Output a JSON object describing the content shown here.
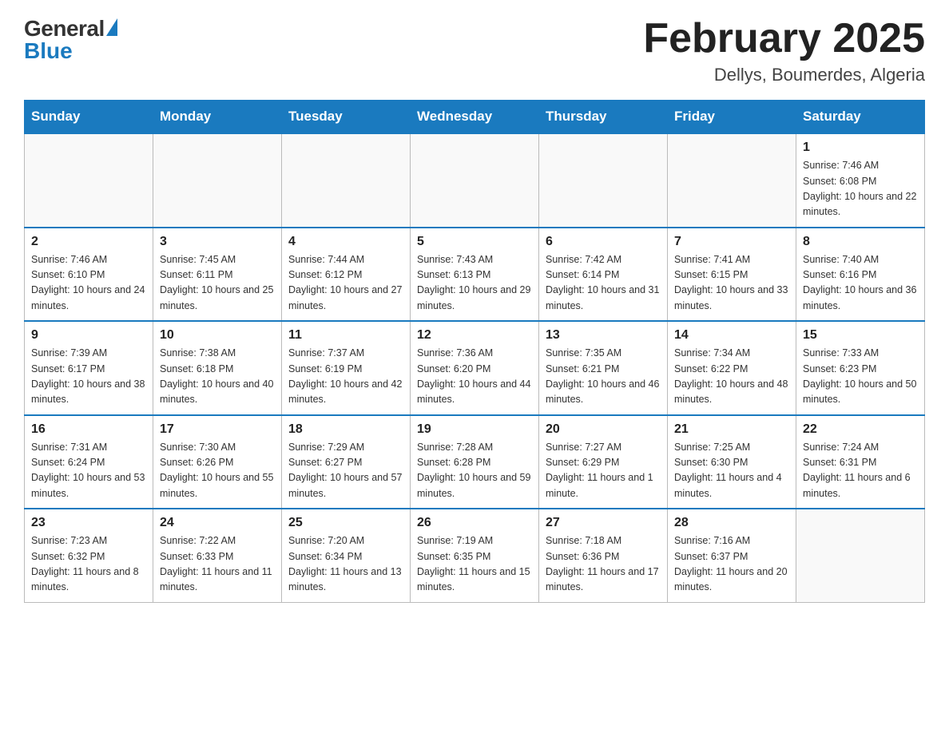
{
  "header": {
    "logo": {
      "general_text": "General",
      "blue_text": "Blue"
    },
    "title": "February 2025",
    "location": "Dellys, Boumerdes, Algeria"
  },
  "days_of_week": [
    "Sunday",
    "Monday",
    "Tuesday",
    "Wednesday",
    "Thursday",
    "Friday",
    "Saturday"
  ],
  "weeks": [
    [
      {
        "day": "",
        "info": ""
      },
      {
        "day": "",
        "info": ""
      },
      {
        "day": "",
        "info": ""
      },
      {
        "day": "",
        "info": ""
      },
      {
        "day": "",
        "info": ""
      },
      {
        "day": "",
        "info": ""
      },
      {
        "day": "1",
        "info": "Sunrise: 7:46 AM\nSunset: 6:08 PM\nDaylight: 10 hours and 22 minutes."
      }
    ],
    [
      {
        "day": "2",
        "info": "Sunrise: 7:46 AM\nSunset: 6:10 PM\nDaylight: 10 hours and 24 minutes."
      },
      {
        "day": "3",
        "info": "Sunrise: 7:45 AM\nSunset: 6:11 PM\nDaylight: 10 hours and 25 minutes."
      },
      {
        "day": "4",
        "info": "Sunrise: 7:44 AM\nSunset: 6:12 PM\nDaylight: 10 hours and 27 minutes."
      },
      {
        "day": "5",
        "info": "Sunrise: 7:43 AM\nSunset: 6:13 PM\nDaylight: 10 hours and 29 minutes."
      },
      {
        "day": "6",
        "info": "Sunrise: 7:42 AM\nSunset: 6:14 PM\nDaylight: 10 hours and 31 minutes."
      },
      {
        "day": "7",
        "info": "Sunrise: 7:41 AM\nSunset: 6:15 PM\nDaylight: 10 hours and 33 minutes."
      },
      {
        "day": "8",
        "info": "Sunrise: 7:40 AM\nSunset: 6:16 PM\nDaylight: 10 hours and 36 minutes."
      }
    ],
    [
      {
        "day": "9",
        "info": "Sunrise: 7:39 AM\nSunset: 6:17 PM\nDaylight: 10 hours and 38 minutes."
      },
      {
        "day": "10",
        "info": "Sunrise: 7:38 AM\nSunset: 6:18 PM\nDaylight: 10 hours and 40 minutes."
      },
      {
        "day": "11",
        "info": "Sunrise: 7:37 AM\nSunset: 6:19 PM\nDaylight: 10 hours and 42 minutes."
      },
      {
        "day": "12",
        "info": "Sunrise: 7:36 AM\nSunset: 6:20 PM\nDaylight: 10 hours and 44 minutes."
      },
      {
        "day": "13",
        "info": "Sunrise: 7:35 AM\nSunset: 6:21 PM\nDaylight: 10 hours and 46 minutes."
      },
      {
        "day": "14",
        "info": "Sunrise: 7:34 AM\nSunset: 6:22 PM\nDaylight: 10 hours and 48 minutes."
      },
      {
        "day": "15",
        "info": "Sunrise: 7:33 AM\nSunset: 6:23 PM\nDaylight: 10 hours and 50 minutes."
      }
    ],
    [
      {
        "day": "16",
        "info": "Sunrise: 7:31 AM\nSunset: 6:24 PM\nDaylight: 10 hours and 53 minutes."
      },
      {
        "day": "17",
        "info": "Sunrise: 7:30 AM\nSunset: 6:26 PM\nDaylight: 10 hours and 55 minutes."
      },
      {
        "day": "18",
        "info": "Sunrise: 7:29 AM\nSunset: 6:27 PM\nDaylight: 10 hours and 57 minutes."
      },
      {
        "day": "19",
        "info": "Sunrise: 7:28 AM\nSunset: 6:28 PM\nDaylight: 10 hours and 59 minutes."
      },
      {
        "day": "20",
        "info": "Sunrise: 7:27 AM\nSunset: 6:29 PM\nDaylight: 11 hours and 1 minute."
      },
      {
        "day": "21",
        "info": "Sunrise: 7:25 AM\nSunset: 6:30 PM\nDaylight: 11 hours and 4 minutes."
      },
      {
        "day": "22",
        "info": "Sunrise: 7:24 AM\nSunset: 6:31 PM\nDaylight: 11 hours and 6 minutes."
      }
    ],
    [
      {
        "day": "23",
        "info": "Sunrise: 7:23 AM\nSunset: 6:32 PM\nDaylight: 11 hours and 8 minutes."
      },
      {
        "day": "24",
        "info": "Sunrise: 7:22 AM\nSunset: 6:33 PM\nDaylight: 11 hours and 11 minutes."
      },
      {
        "day": "25",
        "info": "Sunrise: 7:20 AM\nSunset: 6:34 PM\nDaylight: 11 hours and 13 minutes."
      },
      {
        "day": "26",
        "info": "Sunrise: 7:19 AM\nSunset: 6:35 PM\nDaylight: 11 hours and 15 minutes."
      },
      {
        "day": "27",
        "info": "Sunrise: 7:18 AM\nSunset: 6:36 PM\nDaylight: 11 hours and 17 minutes."
      },
      {
        "day": "28",
        "info": "Sunrise: 7:16 AM\nSunset: 6:37 PM\nDaylight: 11 hours and 20 minutes."
      },
      {
        "day": "",
        "info": ""
      }
    ]
  ]
}
